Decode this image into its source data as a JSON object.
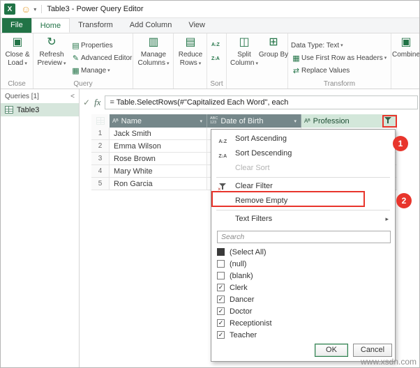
{
  "window": {
    "title": "Table3 - Power Query Editor"
  },
  "tabs": {
    "file": "File",
    "items": [
      "Home",
      "Transform",
      "Add Column",
      "View"
    ],
    "active": "Home"
  },
  "ribbon": {
    "close_load": "Close & Load",
    "close_group_label": "Close",
    "refresh_preview": "Refresh Preview",
    "properties": "Properties",
    "advanced_editor": "Advanced Editor",
    "manage": "Manage",
    "query_group_label": "Query",
    "manage_columns": "Manage Columns",
    "reduce_rows": "Reduce Rows",
    "sort_group_label": "Sort",
    "split_column": "Split Column",
    "group_by": "Group By",
    "data_type": "Data Type: Text",
    "first_row_headers": "Use First Row as Headers",
    "replace_values": "Replace Values",
    "transform_group_label": "Transform",
    "combine": "Combine"
  },
  "queries_panel": {
    "header": "Queries [1]",
    "collapse": "<",
    "items": [
      {
        "name": "Table3"
      }
    ]
  },
  "formula_bar": {
    "fx": "fx",
    "formula": "= Table.SelectRows(#\"Capitalized Each Word\", each"
  },
  "grid": {
    "columns": [
      {
        "type": "Aᴮ",
        "name": "Name"
      },
      {
        "type": "ABC\n123",
        "name": "Date of Birth"
      },
      {
        "type": "Aᴮ",
        "name": "Profession"
      }
    ],
    "rows": [
      {
        "num": "1",
        "name": "Jack Smith"
      },
      {
        "num": "2",
        "name": "Emma Wilson"
      },
      {
        "num": "3",
        "name": "Rose Brown"
      },
      {
        "num": "4",
        "name": "Mary White"
      },
      {
        "num": "5",
        "name": "Ron Garcia"
      }
    ]
  },
  "filter_menu": {
    "sort_ascending": "Sort Ascending",
    "sort_descending": "Sort Descending",
    "clear_sort": "Clear Sort",
    "clear_filter": "Clear Filter",
    "remove_empty": "Remove Empty",
    "text_filters": "Text Filters",
    "search_placeholder": "Search",
    "values": [
      {
        "label": "(Select All)",
        "state": "indeterminate"
      },
      {
        "label": "(null)",
        "state": "unchecked"
      },
      {
        "label": "(blank)",
        "state": "unchecked"
      },
      {
        "label": "Clerk",
        "state": "checked"
      },
      {
        "label": "Dancer",
        "state": "checked"
      },
      {
        "label": "Doctor",
        "state": "checked"
      },
      {
        "label": "Receptionist",
        "state": "checked"
      },
      {
        "label": "Teacher",
        "state": "checked"
      }
    ],
    "ok": "OK",
    "cancel": "Cancel"
  },
  "annotations": {
    "step1": "1",
    "step2": "2"
  },
  "watermark": "www.xsdn.com",
  "icons": {
    "caret_down": "▾",
    "caret_right": "▸",
    "check": "✓",
    "excel": "X",
    "smiley": "☺",
    "close_load": "▣",
    "refresh": "↻",
    "properties": "▤",
    "advanced_editor": "✎",
    "manage": "▦",
    "manage_columns": "▥",
    "reduce_rows": "▤",
    "sort_asc_glyph": "A↓Z",
    "sort_desc_glyph": "Z↓A",
    "split_column": "◫",
    "group_by": "⊞",
    "first_row_headers": "▦",
    "replace_values": "⇄",
    "combine": "▣",
    "clear_filter_x": "×"
  },
  "colors": {
    "excel_green": "#217346",
    "annotation_red": "#e8352c",
    "header_gray": "#75878a",
    "selected_header_green": "#d3e7da"
  }
}
